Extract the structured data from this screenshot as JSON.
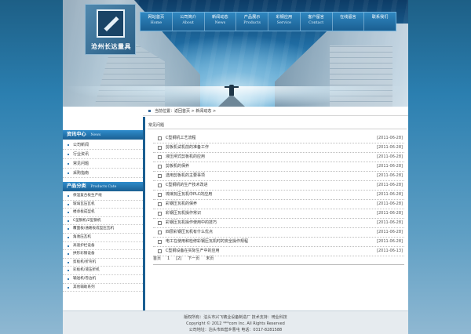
{
  "logo": {
    "name": "沧州长达量具"
  },
  "nav": [
    {
      "cn": "网站首页",
      "en": "Home"
    },
    {
      "cn": "公司简介",
      "en": "About"
    },
    {
      "cn": "新闻动态",
      "en": "News"
    },
    {
      "cn": "产品展示",
      "en": "Products"
    },
    {
      "cn": "彩钢应用",
      "en": "Service"
    },
    {
      "cn": "客户留言",
      "en": "Contact"
    },
    {
      "cn": "在线留言",
      "en": ""
    },
    {
      "cn": "联系我们",
      "en": ""
    }
  ],
  "breadcrumb": "当前位置：返回首页 > 新闻动态 >",
  "sidebar": {
    "news_head": {
      "cn": "资讯中心",
      "en": "News"
    },
    "news_items": [
      "公司新闻",
      "行业资讯",
      "常见问题",
      "采购指南"
    ],
    "prod_head": {
      "cn": "产品分类",
      "en": "Products Cate"
    },
    "prod_items": [
      "保温复合板生产线",
      "玻璃瓦压瓦机",
      "楼承板成型机",
      "C型钢机/Z型钢机",
      "覆面板/通路板成型压瓦机",
      "角驰压瓦机",
      "高速护栏设备",
      "拱形彩钢设备",
      "剪板机/折弯机",
      "彩板机/液压折机",
      "输送机/卷边机",
      "其他辅助系列"
    ]
  },
  "main": {
    "title": "常见问题",
    "articles": [
      {
        "title": "C型钢机工艺流程",
        "date": "[2011-06-28]"
      },
      {
        "title": "剪板机试机前的准备工作",
        "date": "[2011-06-28]"
      },
      {
        "title": "液压闸式剪板机的应用",
        "date": "[2011-06-28]"
      },
      {
        "title": "剪板机的保养",
        "date": "[2011-06-28]"
      },
      {
        "title": "选用剪板机的主要事项",
        "date": "[2011-06-28]"
      },
      {
        "title": "C型钢机的生产技术改进",
        "date": "[2011-06-28]"
      },
      {
        "title": "琉璃瓦压瓦机中PLC的应用",
        "date": "[2011-06-28]"
      },
      {
        "title": "彩钢压瓦机的保养",
        "date": "[2011-06-28]"
      },
      {
        "title": "彩钢压瓦机操作常识",
        "date": "[2011-06-28]"
      },
      {
        "title": "彩钢压瓦机操作使用中的技巧",
        "date": "[2011-06-28]"
      },
      {
        "title": "四层彩钢压瓦机有什么优点",
        "date": "[2011-06-28]"
      },
      {
        "title": "电工在使用和检修彩钢压瓦机时的安全操作规程",
        "date": "[2011-06-28]"
      },
      {
        "title": "C型钢设备在实际生产中的应用",
        "date": "[2011-06-13]"
      }
    ],
    "pager": [
      "首页",
      "1",
      "[2]",
      "下一页",
      "末页"
    ]
  },
  "footer": {
    "line1": "版权所有：泊头市兴飞铸业设备制造厂  技术支持：琦业科技",
    "line2": "Copyright © 2012 ***com Inc. All Rights Reserved",
    "line3": "公司地址：泊头市四营乡曹屯  电话：0317-8281588"
  }
}
